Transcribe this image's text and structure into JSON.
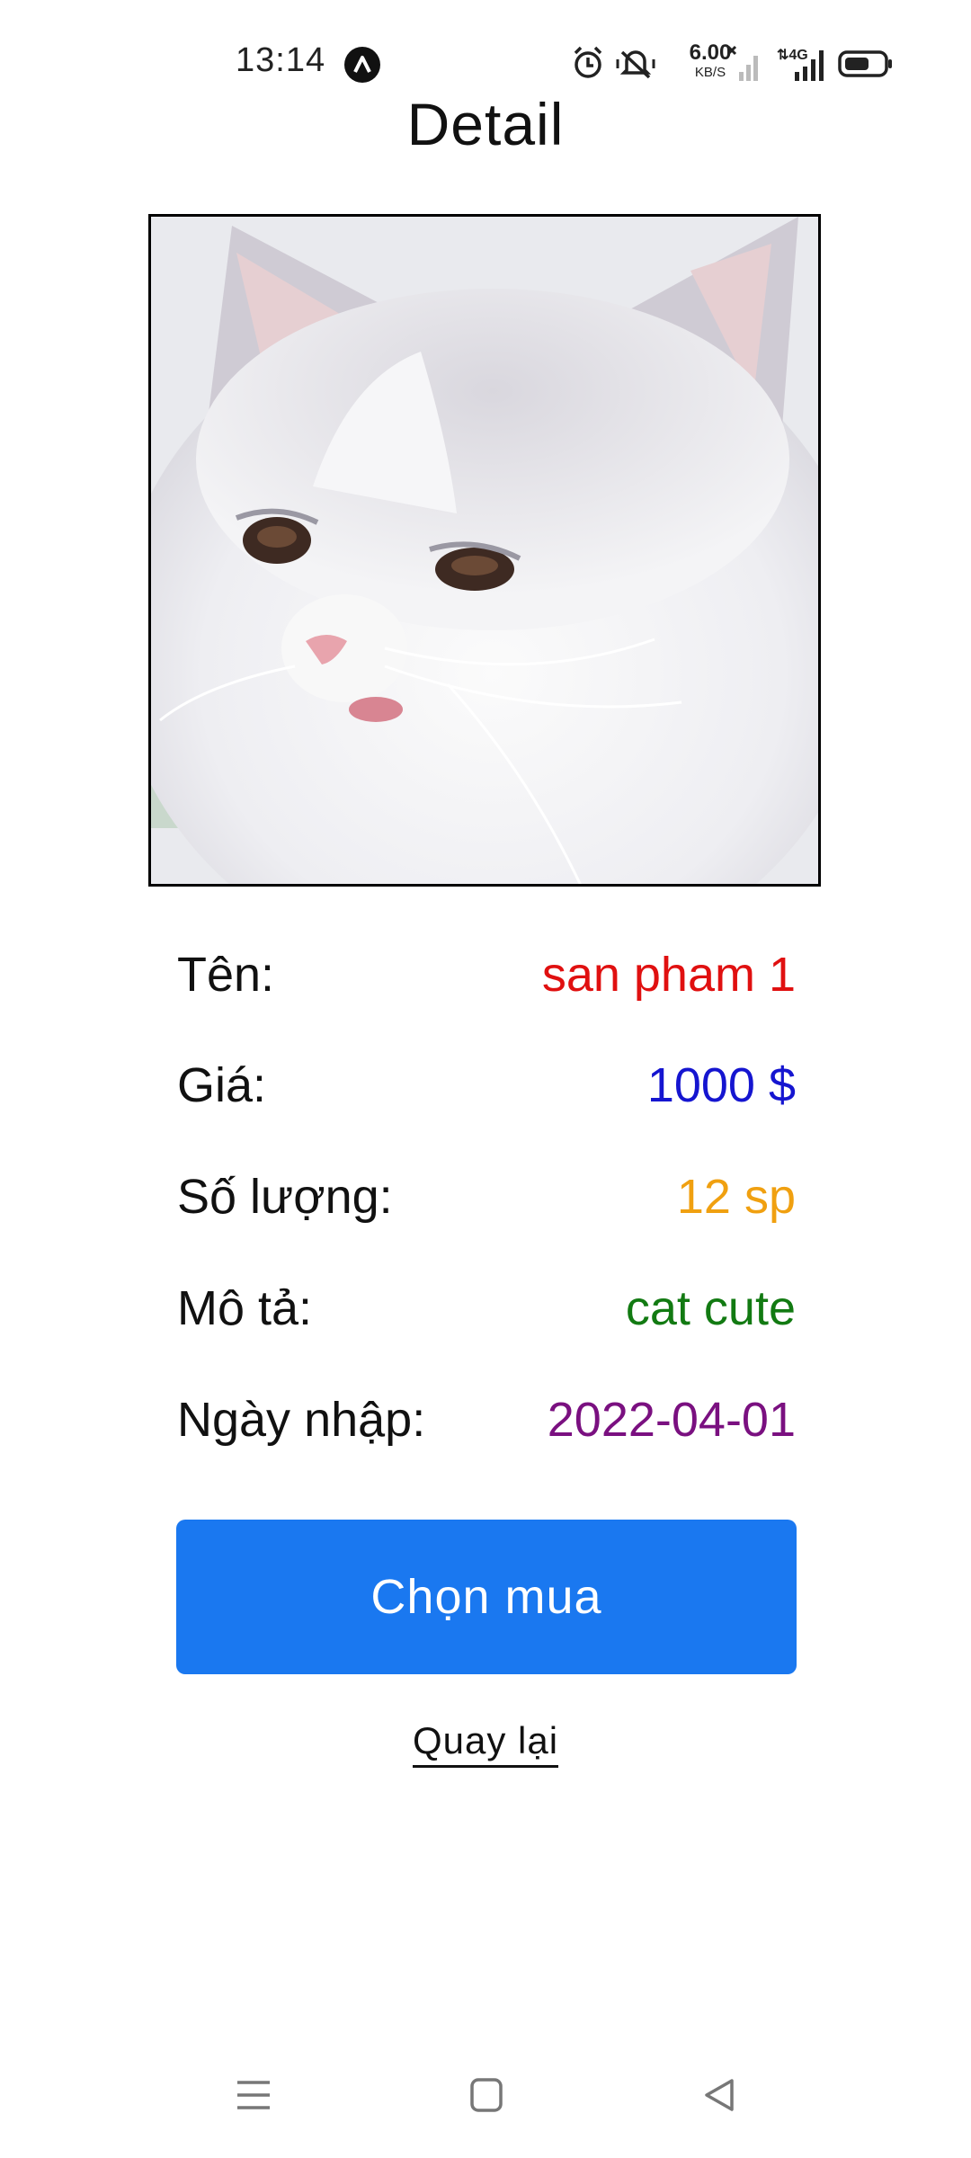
{
  "status_bar": {
    "time": "13:14",
    "speed_value": "6.00",
    "speed_unit": "KB/S",
    "network": "4G",
    "icons": [
      "app-notification-icon",
      "alarm-icon",
      "mute-icon",
      "signal-empty-icon",
      "signal-4g-icon",
      "battery-icon"
    ]
  },
  "page": {
    "title": "Detail"
  },
  "product": {
    "image_alt": "white persian cat",
    "rows": [
      {
        "label": "Tên:",
        "value": "san pham 1",
        "color": "#e01010"
      },
      {
        "label": "Giá:",
        "value": "1000 $",
        "color": "#1515d0"
      },
      {
        "label": "Số lượng:",
        "value": "12 sp",
        "color": "#f0a010"
      },
      {
        "label": "Mô tả:",
        "value": "cat cute",
        "color": "#127a12"
      },
      {
        "label": "Ngày nhập:",
        "value": "2022-04-01",
        "color": "#7a1080"
      }
    ]
  },
  "actions": {
    "buy_label": "Chọn mua",
    "back_label": "Quay lại"
  },
  "colors": {
    "accent": "#1a78f0"
  },
  "nav_bar": {
    "icons": [
      "menu-icon",
      "home-icon",
      "back-icon"
    ]
  }
}
